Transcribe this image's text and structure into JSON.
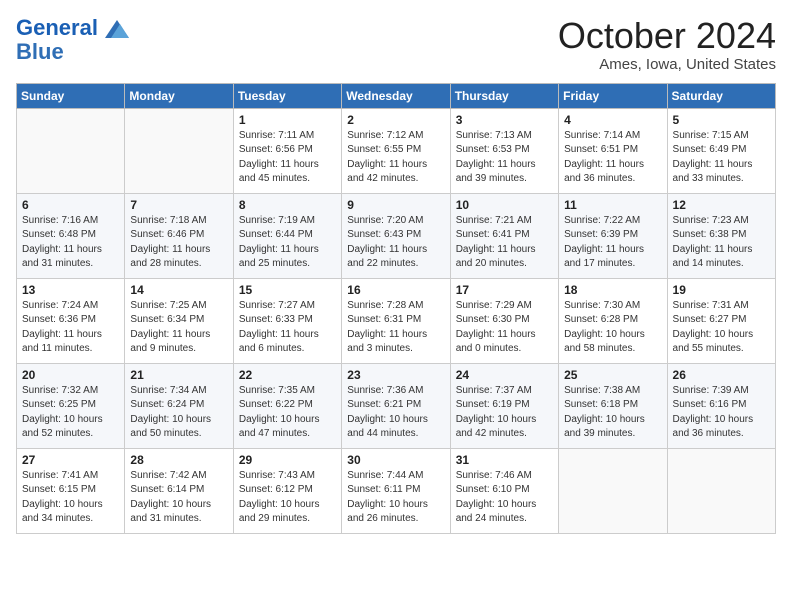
{
  "header": {
    "logo_line1": "General",
    "logo_line2": "Blue",
    "month_title": "October 2024",
    "location": "Ames, Iowa, United States"
  },
  "days_of_week": [
    "Sunday",
    "Monday",
    "Tuesday",
    "Wednesday",
    "Thursday",
    "Friday",
    "Saturday"
  ],
  "weeks": [
    [
      {
        "day": "",
        "info": ""
      },
      {
        "day": "",
        "info": ""
      },
      {
        "day": "1",
        "info": "Sunrise: 7:11 AM\nSunset: 6:56 PM\nDaylight: 11 hours and 45 minutes."
      },
      {
        "day": "2",
        "info": "Sunrise: 7:12 AM\nSunset: 6:55 PM\nDaylight: 11 hours and 42 minutes."
      },
      {
        "day": "3",
        "info": "Sunrise: 7:13 AM\nSunset: 6:53 PM\nDaylight: 11 hours and 39 minutes."
      },
      {
        "day": "4",
        "info": "Sunrise: 7:14 AM\nSunset: 6:51 PM\nDaylight: 11 hours and 36 minutes."
      },
      {
        "day": "5",
        "info": "Sunrise: 7:15 AM\nSunset: 6:49 PM\nDaylight: 11 hours and 33 minutes."
      }
    ],
    [
      {
        "day": "6",
        "info": "Sunrise: 7:16 AM\nSunset: 6:48 PM\nDaylight: 11 hours and 31 minutes."
      },
      {
        "day": "7",
        "info": "Sunrise: 7:18 AM\nSunset: 6:46 PM\nDaylight: 11 hours and 28 minutes."
      },
      {
        "day": "8",
        "info": "Sunrise: 7:19 AM\nSunset: 6:44 PM\nDaylight: 11 hours and 25 minutes."
      },
      {
        "day": "9",
        "info": "Sunrise: 7:20 AM\nSunset: 6:43 PM\nDaylight: 11 hours and 22 minutes."
      },
      {
        "day": "10",
        "info": "Sunrise: 7:21 AM\nSunset: 6:41 PM\nDaylight: 11 hours and 20 minutes."
      },
      {
        "day": "11",
        "info": "Sunrise: 7:22 AM\nSunset: 6:39 PM\nDaylight: 11 hours and 17 minutes."
      },
      {
        "day": "12",
        "info": "Sunrise: 7:23 AM\nSunset: 6:38 PM\nDaylight: 11 hours and 14 minutes."
      }
    ],
    [
      {
        "day": "13",
        "info": "Sunrise: 7:24 AM\nSunset: 6:36 PM\nDaylight: 11 hours and 11 minutes."
      },
      {
        "day": "14",
        "info": "Sunrise: 7:25 AM\nSunset: 6:34 PM\nDaylight: 11 hours and 9 minutes."
      },
      {
        "day": "15",
        "info": "Sunrise: 7:27 AM\nSunset: 6:33 PM\nDaylight: 11 hours and 6 minutes."
      },
      {
        "day": "16",
        "info": "Sunrise: 7:28 AM\nSunset: 6:31 PM\nDaylight: 11 hours and 3 minutes."
      },
      {
        "day": "17",
        "info": "Sunrise: 7:29 AM\nSunset: 6:30 PM\nDaylight: 11 hours and 0 minutes."
      },
      {
        "day": "18",
        "info": "Sunrise: 7:30 AM\nSunset: 6:28 PM\nDaylight: 10 hours and 58 minutes."
      },
      {
        "day": "19",
        "info": "Sunrise: 7:31 AM\nSunset: 6:27 PM\nDaylight: 10 hours and 55 minutes."
      }
    ],
    [
      {
        "day": "20",
        "info": "Sunrise: 7:32 AM\nSunset: 6:25 PM\nDaylight: 10 hours and 52 minutes."
      },
      {
        "day": "21",
        "info": "Sunrise: 7:34 AM\nSunset: 6:24 PM\nDaylight: 10 hours and 50 minutes."
      },
      {
        "day": "22",
        "info": "Sunrise: 7:35 AM\nSunset: 6:22 PM\nDaylight: 10 hours and 47 minutes."
      },
      {
        "day": "23",
        "info": "Sunrise: 7:36 AM\nSunset: 6:21 PM\nDaylight: 10 hours and 44 minutes."
      },
      {
        "day": "24",
        "info": "Sunrise: 7:37 AM\nSunset: 6:19 PM\nDaylight: 10 hours and 42 minutes."
      },
      {
        "day": "25",
        "info": "Sunrise: 7:38 AM\nSunset: 6:18 PM\nDaylight: 10 hours and 39 minutes."
      },
      {
        "day": "26",
        "info": "Sunrise: 7:39 AM\nSunset: 6:16 PM\nDaylight: 10 hours and 36 minutes."
      }
    ],
    [
      {
        "day": "27",
        "info": "Sunrise: 7:41 AM\nSunset: 6:15 PM\nDaylight: 10 hours and 34 minutes."
      },
      {
        "day": "28",
        "info": "Sunrise: 7:42 AM\nSunset: 6:14 PM\nDaylight: 10 hours and 31 minutes."
      },
      {
        "day": "29",
        "info": "Sunrise: 7:43 AM\nSunset: 6:12 PM\nDaylight: 10 hours and 29 minutes."
      },
      {
        "day": "30",
        "info": "Sunrise: 7:44 AM\nSunset: 6:11 PM\nDaylight: 10 hours and 26 minutes."
      },
      {
        "day": "31",
        "info": "Sunrise: 7:46 AM\nSunset: 6:10 PM\nDaylight: 10 hours and 24 minutes."
      },
      {
        "day": "",
        "info": ""
      },
      {
        "day": "",
        "info": ""
      }
    ]
  ]
}
